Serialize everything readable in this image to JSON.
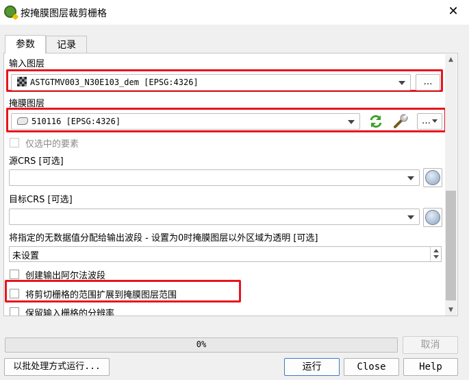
{
  "window": {
    "title": "按掩膜图层裁剪栅格",
    "close_glyph": "✕"
  },
  "tabs": [
    {
      "label": "参数"
    },
    {
      "label": "记录"
    }
  ],
  "params": {
    "input_layer": {
      "label": "输入图层",
      "value": "ASTGTMV003_N30E103_dem [EPSG:4326]",
      "more": "…"
    },
    "mask_layer": {
      "label": "掩膜图层",
      "value": "510116 [EPSG:4326]",
      "more": "…"
    },
    "selected_only": {
      "label": "仅选中的要素"
    },
    "source_crs": {
      "label": "源CRS [可选]",
      "value": ""
    },
    "target_crs": {
      "label": "目标CRS [可选]",
      "value": ""
    },
    "nodata": {
      "label": "将指定的无数据值分配给输出波段 - 设置为0时掩膜图层以外区域为透明 [可选]",
      "value": "未设置"
    },
    "create_alpha": {
      "label": "创建输出阿尔法波段"
    },
    "crop_to_extent": {
      "label": "将剪切栅格的范围扩展到掩膜图层范围"
    },
    "keep_resolution": {
      "label": "保留输入栅格的分辨率"
    }
  },
  "progress": {
    "value": 0,
    "text": "0%"
  },
  "buttons": {
    "cancel": "取消",
    "batch": "以批处理方式运行...",
    "run": "运行",
    "close": "Close",
    "help": "Help"
  },
  "colors": {
    "highlight": "#e8141c",
    "refresh_icon": "#3ca02c"
  }
}
